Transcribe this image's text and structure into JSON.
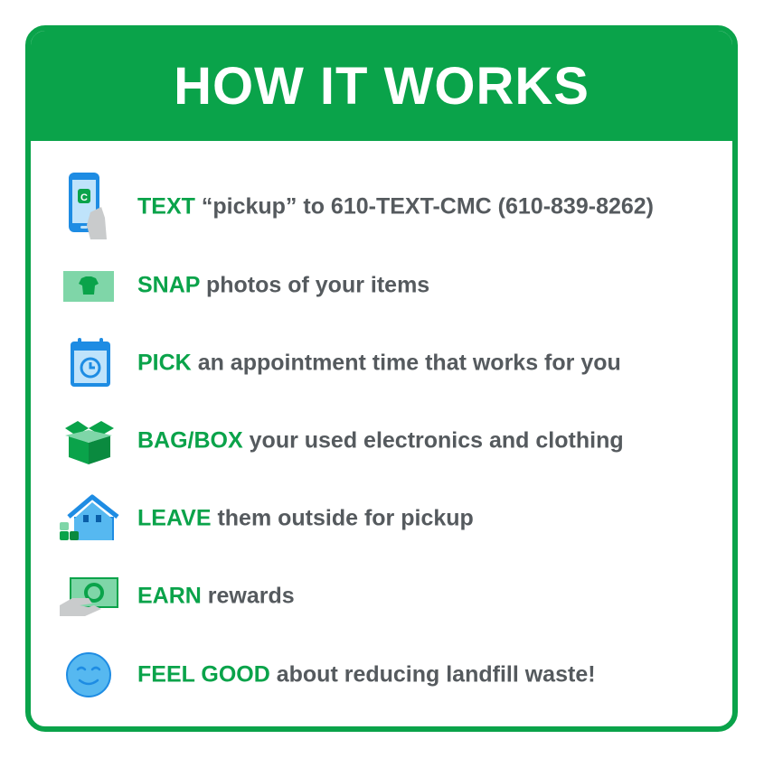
{
  "header": {
    "title": "HOW IT WORKS"
  },
  "steps": [
    {
      "icon": "phone-icon",
      "keyword": "TEXT",
      "text": "“pickup” to 610-TEXT-CMC (610-839-8262)"
    },
    {
      "icon": "shirt-photo-icon",
      "keyword": "SNAP",
      "text": "photos of your items"
    },
    {
      "icon": "calendar-clock-icon",
      "keyword": "PICK",
      "text": "an appointment time that works for you"
    },
    {
      "icon": "open-box-icon",
      "keyword": "BAG/BOX",
      "text": "your used electronics and clothing"
    },
    {
      "icon": "house-icon",
      "keyword": "LEAVE",
      "text": "them outside for pickup"
    },
    {
      "icon": "cash-hand-icon",
      "keyword": "EARN",
      "text": "rewards"
    },
    {
      "icon": "smiley-face-icon",
      "keyword": "FEEL GOOD",
      "text": "about reducing landfill waste!"
    }
  ],
  "colors": {
    "brand_green": "#0aa34a",
    "text_gray": "#555a5e",
    "icon_blue": "#1e8ce3"
  }
}
